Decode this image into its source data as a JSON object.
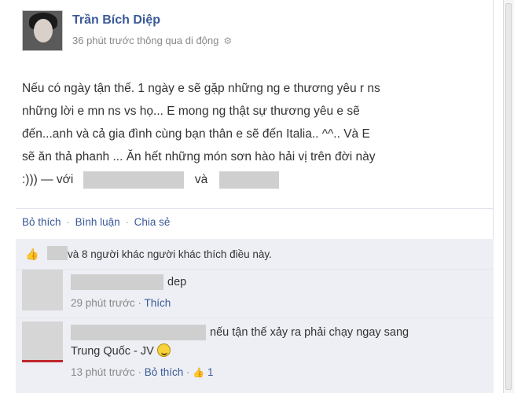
{
  "post": {
    "author": "Trần Bích Diệp",
    "meta": "36 phút trước thông qua di động",
    "body_lines": [
      "Nếu có ngày tận thế. 1 ngày e sẽ gặp những ng e thương yêu r ns",
      "những lời e mn ns vs họ... E mong ng thật sự thương yêu e sẽ",
      "đến...anh và cả gia đình cùng bạn thân e sẽ đến Italia.. ^^.. Và E",
      "sẽ ăn thả phanh ... Ăn hết những món sơn hào hải vị trên đời này"
    ],
    "with_prefix": ":))) — với",
    "with_and": "và"
  },
  "actions": {
    "like": "Bỏ thích",
    "comment": "Bình luận",
    "share": "Chia sẻ",
    "separator": "·"
  },
  "likes": {
    "text": "và 8 người khác người khác thích điều này."
  },
  "comments": [
    {
      "text": "dep",
      "time": "29 phút trước",
      "action": "Thích"
    },
    {
      "text_line1": "nếu tận thế xảy ra phải chạy ngay sang",
      "text_line2": "Trung Quốc - JV",
      "time": "13 phút trước",
      "action": "Bỏ thích",
      "like_count": "1"
    }
  ],
  "icons": {
    "gear": "gear-icon",
    "like": "thumbs-up-icon",
    "emoticon": "smiley-emoticon"
  },
  "colors": {
    "link": "#3b5998",
    "panel": "#edeff4"
  }
}
